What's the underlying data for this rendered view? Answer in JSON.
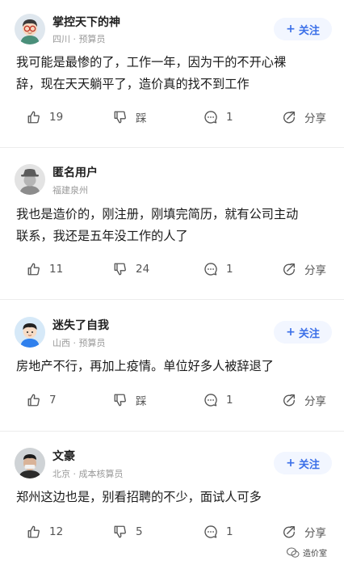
{
  "follow_label": "关注",
  "share_label": "分享",
  "posts": [
    {
      "name": "掌控天下的神",
      "meta": "四川 · 预算员",
      "follow": true,
      "text_lines": [
        "我可能是最惨的了，工作一年，因为干的不开心裸",
        "辞，现在天天躺平了，造价真的找不到工作"
      ],
      "likes": "19",
      "dislikes": "踩",
      "comments": "1"
    },
    {
      "name": "匿名用户",
      "meta": "福建泉州",
      "follow": false,
      "text_lines": [
        "我也是造价的，刚注册，刚填完简历，就有公司主动",
        "联系，我还是五年没工作的人了"
      ],
      "likes": "11",
      "dislikes": "24",
      "comments": "1"
    },
    {
      "name": "迷失了自我",
      "meta": "山西 · 预算员",
      "follow": true,
      "text_lines": [
        "房地产不行，再加上疫情。单位好多人被辞退了"
      ],
      "likes": "7",
      "dislikes": "踩",
      "comments": "1"
    },
    {
      "name": "文豪",
      "meta": "北京 · 成本核算员",
      "follow": true,
      "text_lines": [
        "郑州这边也是，别看招聘的不少，面试人可多"
      ],
      "likes": "12",
      "dislikes": "5",
      "comments": "1"
    }
  ],
  "watermark": "造价室",
  "colors": {
    "accent": "#3b6fe8",
    "follow_bg": "#f2f6ff",
    "muted": "#999999",
    "divider": "#ececec"
  }
}
